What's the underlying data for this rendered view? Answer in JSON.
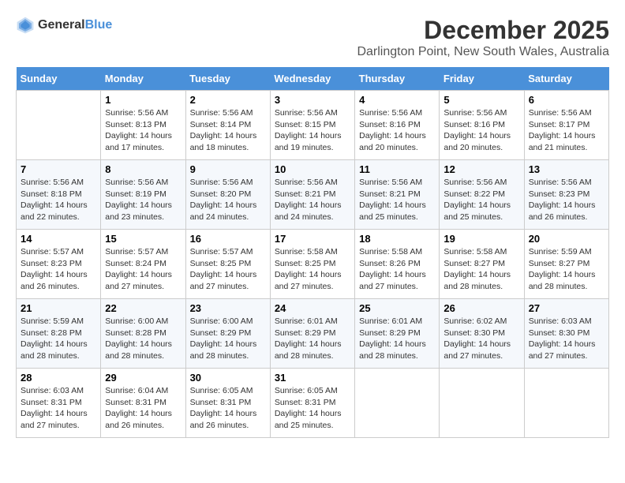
{
  "logo": {
    "general": "General",
    "blue": "Blue"
  },
  "title": "December 2025",
  "subtitle": "Darlington Point, New South Wales, Australia",
  "weekdays": [
    "Sunday",
    "Monday",
    "Tuesday",
    "Wednesday",
    "Thursday",
    "Friday",
    "Saturday"
  ],
  "weeks": [
    [
      {
        "day": "",
        "info": ""
      },
      {
        "day": "1",
        "info": "Sunrise: 5:56 AM\nSunset: 8:13 PM\nDaylight: 14 hours\nand 17 minutes."
      },
      {
        "day": "2",
        "info": "Sunrise: 5:56 AM\nSunset: 8:14 PM\nDaylight: 14 hours\nand 18 minutes."
      },
      {
        "day": "3",
        "info": "Sunrise: 5:56 AM\nSunset: 8:15 PM\nDaylight: 14 hours\nand 19 minutes."
      },
      {
        "day": "4",
        "info": "Sunrise: 5:56 AM\nSunset: 8:16 PM\nDaylight: 14 hours\nand 20 minutes."
      },
      {
        "day": "5",
        "info": "Sunrise: 5:56 AM\nSunset: 8:16 PM\nDaylight: 14 hours\nand 20 minutes."
      },
      {
        "day": "6",
        "info": "Sunrise: 5:56 AM\nSunset: 8:17 PM\nDaylight: 14 hours\nand 21 minutes."
      }
    ],
    [
      {
        "day": "7",
        "info": "Sunrise: 5:56 AM\nSunset: 8:18 PM\nDaylight: 14 hours\nand 22 minutes."
      },
      {
        "day": "8",
        "info": "Sunrise: 5:56 AM\nSunset: 8:19 PM\nDaylight: 14 hours\nand 23 minutes."
      },
      {
        "day": "9",
        "info": "Sunrise: 5:56 AM\nSunset: 8:20 PM\nDaylight: 14 hours\nand 24 minutes."
      },
      {
        "day": "10",
        "info": "Sunrise: 5:56 AM\nSunset: 8:21 PM\nDaylight: 14 hours\nand 24 minutes."
      },
      {
        "day": "11",
        "info": "Sunrise: 5:56 AM\nSunset: 8:21 PM\nDaylight: 14 hours\nand 25 minutes."
      },
      {
        "day": "12",
        "info": "Sunrise: 5:56 AM\nSunset: 8:22 PM\nDaylight: 14 hours\nand 25 minutes."
      },
      {
        "day": "13",
        "info": "Sunrise: 5:56 AM\nSunset: 8:23 PM\nDaylight: 14 hours\nand 26 minutes."
      }
    ],
    [
      {
        "day": "14",
        "info": "Sunrise: 5:57 AM\nSunset: 8:23 PM\nDaylight: 14 hours\nand 26 minutes."
      },
      {
        "day": "15",
        "info": "Sunrise: 5:57 AM\nSunset: 8:24 PM\nDaylight: 14 hours\nand 27 minutes."
      },
      {
        "day": "16",
        "info": "Sunrise: 5:57 AM\nSunset: 8:25 PM\nDaylight: 14 hours\nand 27 minutes."
      },
      {
        "day": "17",
        "info": "Sunrise: 5:58 AM\nSunset: 8:25 PM\nDaylight: 14 hours\nand 27 minutes."
      },
      {
        "day": "18",
        "info": "Sunrise: 5:58 AM\nSunset: 8:26 PM\nDaylight: 14 hours\nand 27 minutes."
      },
      {
        "day": "19",
        "info": "Sunrise: 5:58 AM\nSunset: 8:27 PM\nDaylight: 14 hours\nand 28 minutes."
      },
      {
        "day": "20",
        "info": "Sunrise: 5:59 AM\nSunset: 8:27 PM\nDaylight: 14 hours\nand 28 minutes."
      }
    ],
    [
      {
        "day": "21",
        "info": "Sunrise: 5:59 AM\nSunset: 8:28 PM\nDaylight: 14 hours\nand 28 minutes."
      },
      {
        "day": "22",
        "info": "Sunrise: 6:00 AM\nSunset: 8:28 PM\nDaylight: 14 hours\nand 28 minutes."
      },
      {
        "day": "23",
        "info": "Sunrise: 6:00 AM\nSunset: 8:29 PM\nDaylight: 14 hours\nand 28 minutes."
      },
      {
        "day": "24",
        "info": "Sunrise: 6:01 AM\nSunset: 8:29 PM\nDaylight: 14 hours\nand 28 minutes."
      },
      {
        "day": "25",
        "info": "Sunrise: 6:01 AM\nSunset: 8:29 PM\nDaylight: 14 hours\nand 28 minutes."
      },
      {
        "day": "26",
        "info": "Sunrise: 6:02 AM\nSunset: 8:30 PM\nDaylight: 14 hours\nand 27 minutes."
      },
      {
        "day": "27",
        "info": "Sunrise: 6:03 AM\nSunset: 8:30 PM\nDaylight: 14 hours\nand 27 minutes."
      }
    ],
    [
      {
        "day": "28",
        "info": "Sunrise: 6:03 AM\nSunset: 8:31 PM\nDaylight: 14 hours\nand 27 minutes."
      },
      {
        "day": "29",
        "info": "Sunrise: 6:04 AM\nSunset: 8:31 PM\nDaylight: 14 hours\nand 26 minutes."
      },
      {
        "day": "30",
        "info": "Sunrise: 6:05 AM\nSunset: 8:31 PM\nDaylight: 14 hours\nand 26 minutes."
      },
      {
        "day": "31",
        "info": "Sunrise: 6:05 AM\nSunset: 8:31 PM\nDaylight: 14 hours\nand 25 minutes."
      },
      {
        "day": "",
        "info": ""
      },
      {
        "day": "",
        "info": ""
      },
      {
        "day": "",
        "info": ""
      }
    ]
  ]
}
